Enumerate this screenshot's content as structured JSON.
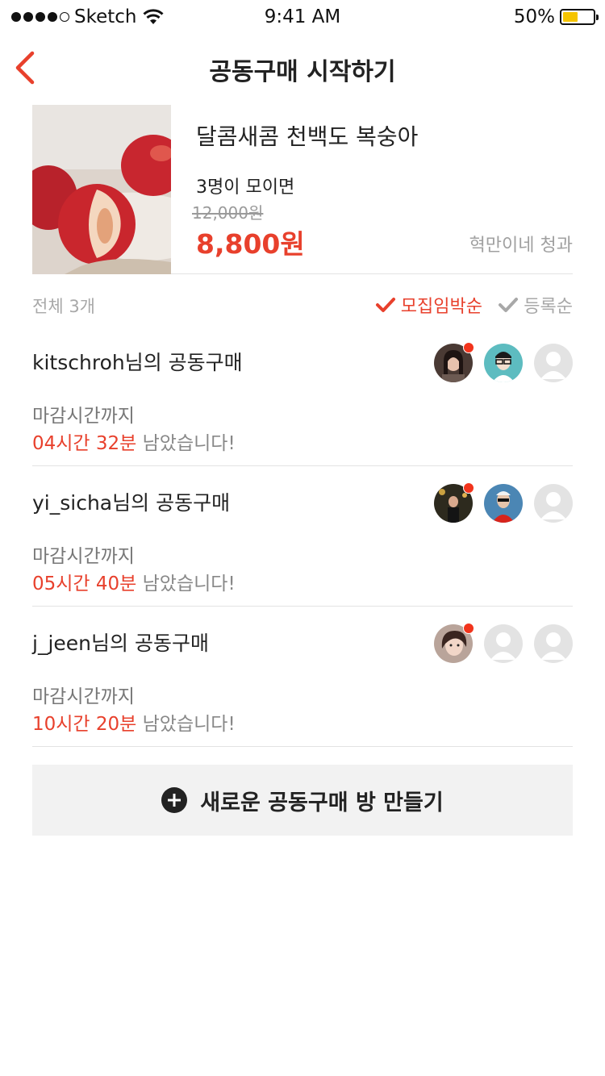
{
  "status_bar": {
    "carrier": "Sketch",
    "time": "9:41 AM",
    "battery": "50%",
    "battery_level": 0.5
  },
  "nav": {
    "title": "공동구매 시작하기"
  },
  "product": {
    "name": "달콤새콤 천백도 복숭아",
    "group_condition": "3명이 모이면",
    "original_price": "12,000원",
    "sale_price": "8,800원",
    "seller": "혁만이네 청과"
  },
  "sortbar": {
    "total": "전체 3개",
    "sort_active": "모집임박순",
    "sort_inactive": "등록순"
  },
  "groups": [
    {
      "title": "kitschroh님의 공동구매",
      "deadline_label": "마감시간까지",
      "remaining_time": "04시간 32분",
      "remaining_suffix": " 남았습니다!",
      "avatars": [
        "member-photo",
        "member-cartoon",
        "empty-slot"
      ]
    },
    {
      "title": "yi_sicha님의 공동구매",
      "deadline_label": "마감시간까지",
      "remaining_time": "05시간 40분",
      "remaining_suffix": " 남았습니다!",
      "avatars": [
        "member-photo",
        "member-photo",
        "empty-slot"
      ]
    },
    {
      "title": "j_jeen님의 공동구매",
      "deadline_label": "마감시간까지",
      "remaining_time": "10시간 20분",
      "remaining_suffix": " 남았습니다!",
      "avatars": [
        "member-photo",
        "empty-slot",
        "empty-slot"
      ]
    }
  ],
  "new_room_button": {
    "label": "새로운 공동구매 방 만들기"
  },
  "colors": {
    "accent": "#e8402c",
    "battery": "#f5c400",
    "button_bg": "#f2f2f2"
  }
}
